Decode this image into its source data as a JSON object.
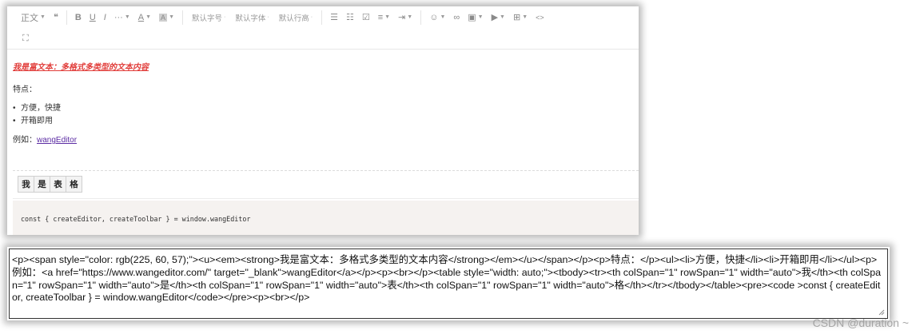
{
  "toolbar": {
    "row1": [
      {
        "type": "dropdown",
        "name": "paragraph-style-dropdown",
        "label": "正文"
      },
      {
        "type": "icon",
        "name": "blockquote-icon",
        "glyph": "❝"
      },
      {
        "type": "sep"
      },
      {
        "type": "icon",
        "name": "bold-icon",
        "glyph": "B"
      },
      {
        "type": "icon",
        "name": "underline-icon",
        "glyph": "U"
      },
      {
        "type": "icon",
        "name": "italic-icon",
        "glyph": "I"
      },
      {
        "type": "dropdown",
        "name": "more-style-dropdown",
        "label": "···"
      },
      {
        "type": "dropdown",
        "name": "font-color-dropdown",
        "label": "A"
      },
      {
        "type": "dropdown",
        "name": "bg-color-dropdown",
        "label": "A"
      },
      {
        "type": "sep"
      },
      {
        "type": "text",
        "name": "font-size-select",
        "label": "默认字号"
      },
      {
        "type": "text",
        "name": "font-family-select",
        "label": "默认字体"
      },
      {
        "type": "text",
        "name": "line-height-select",
        "label": "默认行高"
      },
      {
        "type": "sep"
      },
      {
        "type": "icon",
        "name": "bulleted-list-icon",
        "glyph": "☰"
      },
      {
        "type": "icon",
        "name": "numbered-list-icon",
        "glyph": "☷"
      },
      {
        "type": "icon",
        "name": "todo-icon",
        "glyph": "☑"
      },
      {
        "type": "dropdown",
        "name": "align-dropdown",
        "label": "≡"
      },
      {
        "type": "dropdown",
        "name": "indent-dropdown",
        "label": "⇥"
      },
      {
        "type": "sep"
      },
      {
        "type": "dropdown",
        "name": "emoji-dropdown",
        "label": "☺"
      },
      {
        "type": "icon",
        "name": "link-icon",
        "glyph": "∞"
      },
      {
        "type": "dropdown",
        "name": "image-dropdown",
        "label": "▣"
      },
      {
        "type": "dropdown",
        "name": "video-dropdown",
        "label": "▶"
      },
      {
        "type": "dropdown",
        "name": "table-dropdown",
        "label": "⊞"
      },
      {
        "type": "icon",
        "name": "code-icon",
        "glyph": "<>"
      }
    ],
    "row2": [
      {
        "type": "icon",
        "name": "fullscreen-icon",
        "glyph": "⛶"
      }
    ]
  },
  "content": {
    "title": "我是富文本：多格式多类型的文本内容",
    "title_color": "#e13c39",
    "features_label": "特点：",
    "bullets": [
      "方便，快捷",
      "开箱即用"
    ],
    "example_label": "例如：",
    "example_link": "wangEditor",
    "table_cells": [
      "我",
      "是",
      "表",
      "格"
    ],
    "code": "const { createEditor, createToolbar } = window.wangEditor"
  },
  "output": {
    "html": "<p><span style=\"color: rgb(225, 60, 57);\"><u><em><strong>我是富文本：多格式多类型的文本内容</strong></em></u></span></p><p>特点：</p><ul><li>方便，快捷</li><li>开箱即用</li></ul><p>例如：<a href=\"https://www.wangeditor.com/\" target=\"_blank\">wangEditor</a></p><p><br></p><table style=\"width: auto;\"><tbody><tr><th colSpan=\"1\" rowSpan=\"1\" width=\"auto\">我</th><th colSpan=\"1\" rowSpan=\"1\" width=\"auto\">是</th><th colSpan=\"1\" rowSpan=\"1\" width=\"auto\">表</th><th colSpan=\"1\" rowSpan=\"1\" width=\"auto\">格</th></tr></tbody></table><pre><code >const { createEditor, createToolbar } = window.wangEditor</code></pre><p><br></p>"
  },
  "watermark": "CSDN @duration ~"
}
